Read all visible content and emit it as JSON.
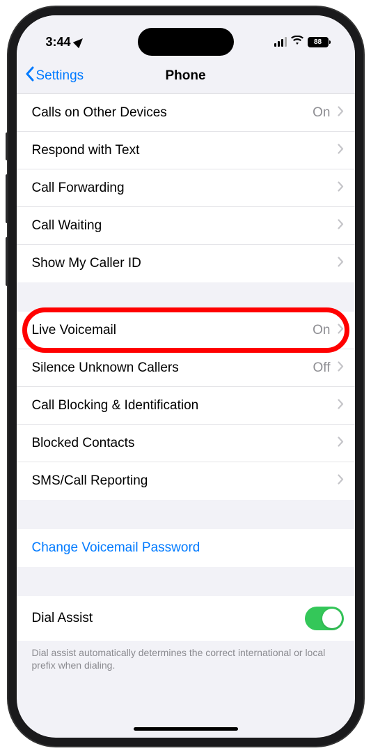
{
  "status_bar": {
    "time": "3:44",
    "location_active": true,
    "battery_percent": "88"
  },
  "nav": {
    "back_label": "Settings",
    "title": "Phone"
  },
  "group1": [
    {
      "label": "Calls on Other Devices",
      "value": "On"
    },
    {
      "label": "Respond with Text",
      "value": ""
    },
    {
      "label": "Call Forwarding",
      "value": ""
    },
    {
      "label": "Call Waiting",
      "value": ""
    },
    {
      "label": "Show My Caller ID",
      "value": ""
    }
  ],
  "group2": [
    {
      "label": "Live Voicemail",
      "value": "On",
      "highlighted": true
    },
    {
      "label": "Silence Unknown Callers",
      "value": "Off"
    },
    {
      "label": "Call Blocking & Identification",
      "value": ""
    },
    {
      "label": "Blocked Contacts",
      "value": ""
    },
    {
      "label": "SMS/Call Reporting",
      "value": ""
    }
  ],
  "group3": {
    "link_label": "Change Voicemail Password"
  },
  "group4": {
    "label": "Dial Assist",
    "toggle_on": true,
    "footer": "Dial assist automatically determines the correct international or local prefix when dialing."
  }
}
